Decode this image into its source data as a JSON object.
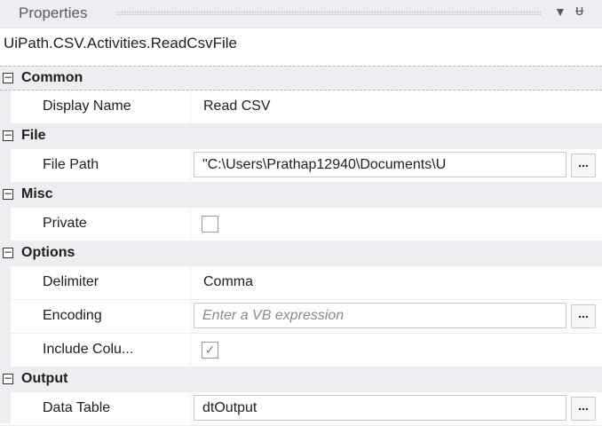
{
  "panel": {
    "title": "Properties",
    "dropdown_icon": "▼",
    "pin_icon": "ᵾ",
    "activity_type": "UiPath.CSV.Activities.ReadCsvFile"
  },
  "categories": {
    "common": {
      "toggle": "−",
      "label": "Common",
      "display_name": {
        "label": "Display Name",
        "value": "Read CSV"
      }
    },
    "file": {
      "toggle": "−",
      "label": "File",
      "file_path": {
        "label": "File Path",
        "value": "\"C:\\Users\\Prathap12940\\Documents\\U",
        "button": "..."
      }
    },
    "misc": {
      "toggle": "−",
      "label": "Misc",
      "private": {
        "label": "Private",
        "checked": false
      }
    },
    "options": {
      "toggle": "−",
      "label": "Options",
      "delimiter": {
        "label": "Delimiter",
        "value": "Comma"
      },
      "encoding": {
        "label": "Encoding",
        "placeholder": "Enter a VB expression",
        "button": "..."
      },
      "include_columns": {
        "label": "Include Colu...",
        "checked": true,
        "check_glyph": "✓"
      }
    },
    "output": {
      "toggle": "−",
      "label": "Output",
      "data_table": {
        "label": "Data Table",
        "value": "dtOutput",
        "button": "..."
      }
    }
  }
}
